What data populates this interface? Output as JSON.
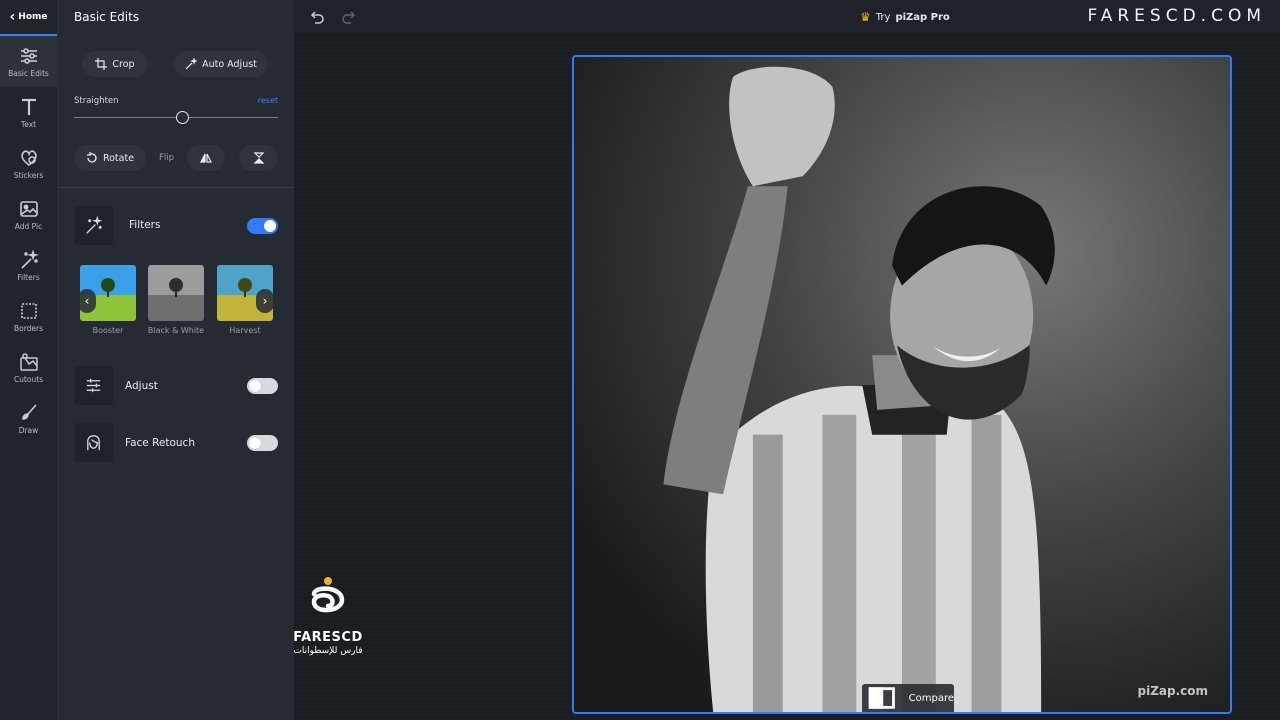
{
  "rail": {
    "home": "Home",
    "items": [
      {
        "label": "Basic Edits",
        "icon": "sliders-icon",
        "active": true
      },
      {
        "label": "Text",
        "icon": "text-icon"
      },
      {
        "label": "Stickers",
        "icon": "stickers-icon"
      },
      {
        "label": "Add Pic",
        "icon": "add-picture-icon"
      },
      {
        "label": "Filters",
        "icon": "magic-wand-icon"
      },
      {
        "label": "Borders",
        "icon": "border-icon"
      },
      {
        "label": "Cutouts",
        "icon": "cutout-icon"
      },
      {
        "label": "Draw",
        "icon": "brush-icon"
      }
    ]
  },
  "panel": {
    "title": "Basic Edits",
    "crop_label": "Crop",
    "auto_adjust_label": "Auto Adjust",
    "straighten_label": "Straighten",
    "reset_label": "reset",
    "straighten_value": 0.5,
    "rotate_label": "Rotate",
    "flip_label": "Flip",
    "filters": {
      "label": "Filters",
      "enabled": true,
      "thumbs": [
        "Booster",
        "Black & White",
        "Harvest"
      ]
    },
    "adjust": {
      "label": "Adjust",
      "enabled": false
    },
    "face_retouch": {
      "label": "Face Retouch",
      "enabled": false
    }
  },
  "topbar": {
    "try_label": "Try",
    "pro_label": "piZap Pro",
    "brand": "FARESCD.COM"
  },
  "canvas": {
    "watermark": "piZap.com",
    "compare_label": "Compare"
  },
  "logo": {
    "name": "FARESCD",
    "arabic": "فارس للإسطوانات"
  },
  "colors": {
    "accent": "#2f7cf6",
    "crown": "#f0b323"
  }
}
